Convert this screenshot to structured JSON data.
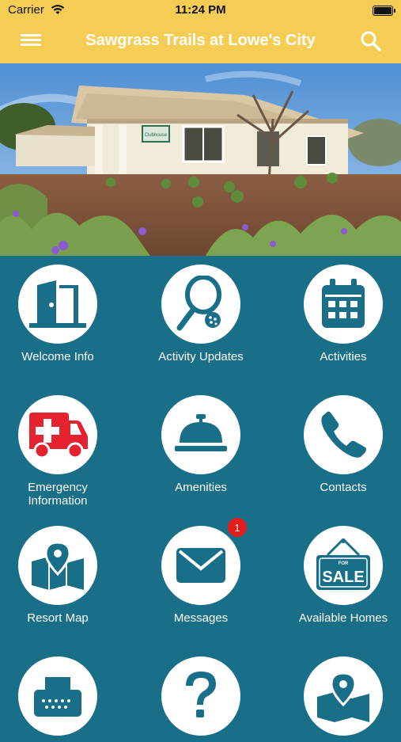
{
  "status": {
    "carrier": "Carrier",
    "time": "11:24 PM"
  },
  "header": {
    "title": "Sawgrass Trails at Lowe's City"
  },
  "hero": {
    "sign_text": "Clubhouse"
  },
  "tiles": [
    {
      "label": "Welcome Info",
      "icon": "door-icon"
    },
    {
      "label": "Activity Updates",
      "icon": "pickleball-icon"
    },
    {
      "label": "Activities",
      "icon": "calendar-icon"
    },
    {
      "label": "Emergency\nInformation",
      "icon": "ambulance-icon"
    },
    {
      "label": "Amenities",
      "icon": "service-bell-icon"
    },
    {
      "label": "Contacts",
      "icon": "phone-icon"
    },
    {
      "label": "Resort Map",
      "icon": "map-icon"
    },
    {
      "label": "Messages",
      "icon": "envelope-icon",
      "badge": "1"
    },
    {
      "label": "Available Homes",
      "icon": "for-sale-sign-icon",
      "sign_top": "FOR",
      "sign_text": "SALE"
    },
    {
      "label": "",
      "icon": "typewriter-icon"
    },
    {
      "label": "",
      "icon": "question-icon"
    },
    {
      "label": "",
      "icon": "map-pin-icon"
    }
  ],
  "colors": {
    "header": "#f5cd55",
    "background": "#1a6f88",
    "icon": "#1a6f88",
    "emergency": "#e52330",
    "badge": "#e51b1b"
  }
}
